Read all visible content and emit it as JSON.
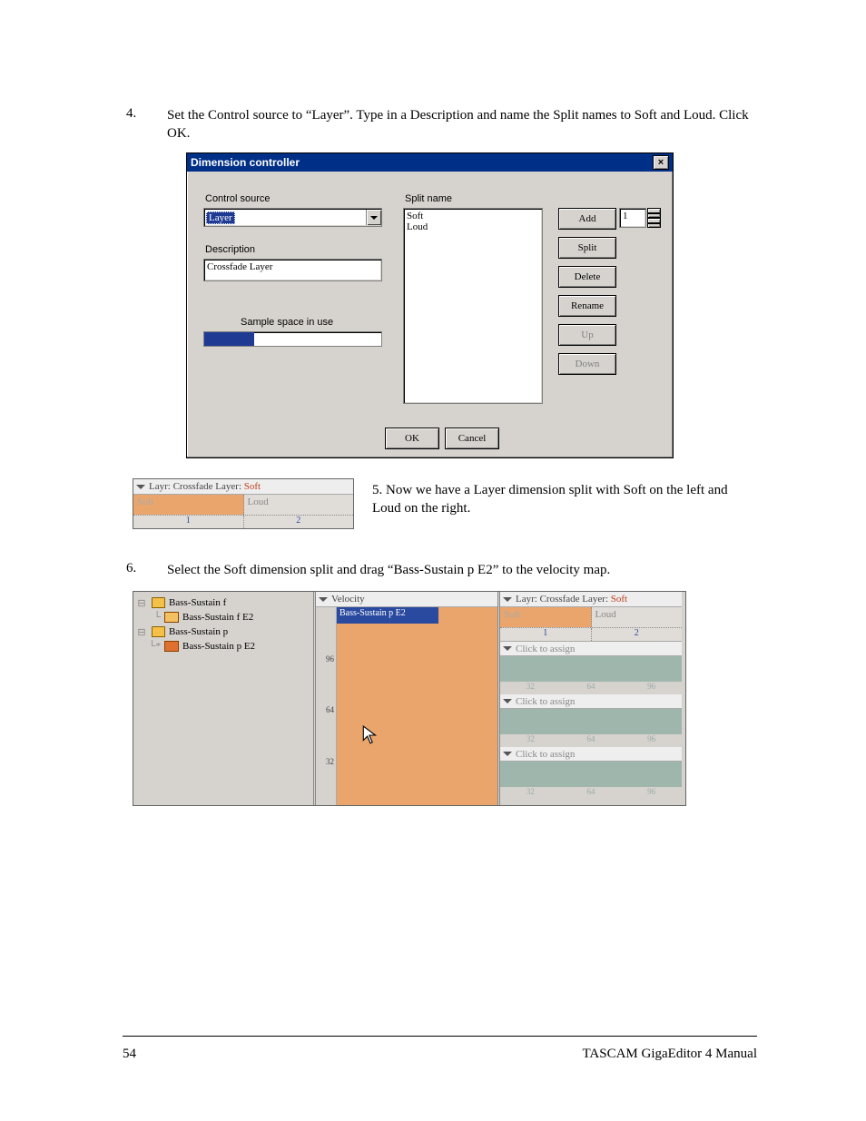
{
  "step4": {
    "number": "4.",
    "text": "Set the Control source to “Layer”.  Type in a Description and name the Split names to Soft and Loud. Click OK."
  },
  "dialog": {
    "title": "Dimension controller",
    "labels": {
      "control_source": "Control source",
      "split_name": "Split name",
      "description": "Description",
      "sample_space": "Sample space in use"
    },
    "control_source_value": "Layer",
    "description_value": "Crossfade Layer",
    "split_items": [
      "Soft",
      "Loud"
    ],
    "spinner_value": "1",
    "buttons": {
      "add": "Add",
      "split": "Split",
      "delete": "Delete",
      "rename": "Rename",
      "up": "Up",
      "down": "Down",
      "ok": "OK",
      "cancel": "Cancel"
    },
    "progress_percent": 28
  },
  "step5": {
    "number": "5.",
    "text": "Now we have a Layer dimension split with Soft on the left and Loud on the right."
  },
  "layr_small": {
    "header_prefix": "Layr: Crossfade Layer:",
    "header_active": "Soft",
    "cells": [
      "Soft",
      "Loud"
    ],
    "nums": [
      "1",
      "2"
    ]
  },
  "step6": {
    "number": "6.",
    "text": "Select the Soft dimension split and drag “Bass-Sustain p E2” to the velocity map."
  },
  "editor": {
    "tree": {
      "n1": "Bass-Sustain f",
      "n1a": "Bass-Sustain f E2",
      "n2": "Bass-Sustain p",
      "n2a": "Bass-Sustain p E2"
    },
    "velocity": {
      "header": "Velocity",
      "drag_label": "Bass-Sustain p E2",
      "ticks": [
        "96",
        "64",
        "32"
      ]
    },
    "right": {
      "layr_header_prefix": "Layr: Crossfade Layer:",
      "layr_header_active": "Soft",
      "layr_cells": [
        "Soft",
        "Loud"
      ],
      "layr_nums": [
        "1",
        "2"
      ],
      "assign_label": "Click to assign",
      "assign_nums": [
        "32",
        "64",
        "96"
      ]
    }
  },
  "footer": {
    "page": "54",
    "title": "TASCAM GigaEditor 4 Manual"
  }
}
